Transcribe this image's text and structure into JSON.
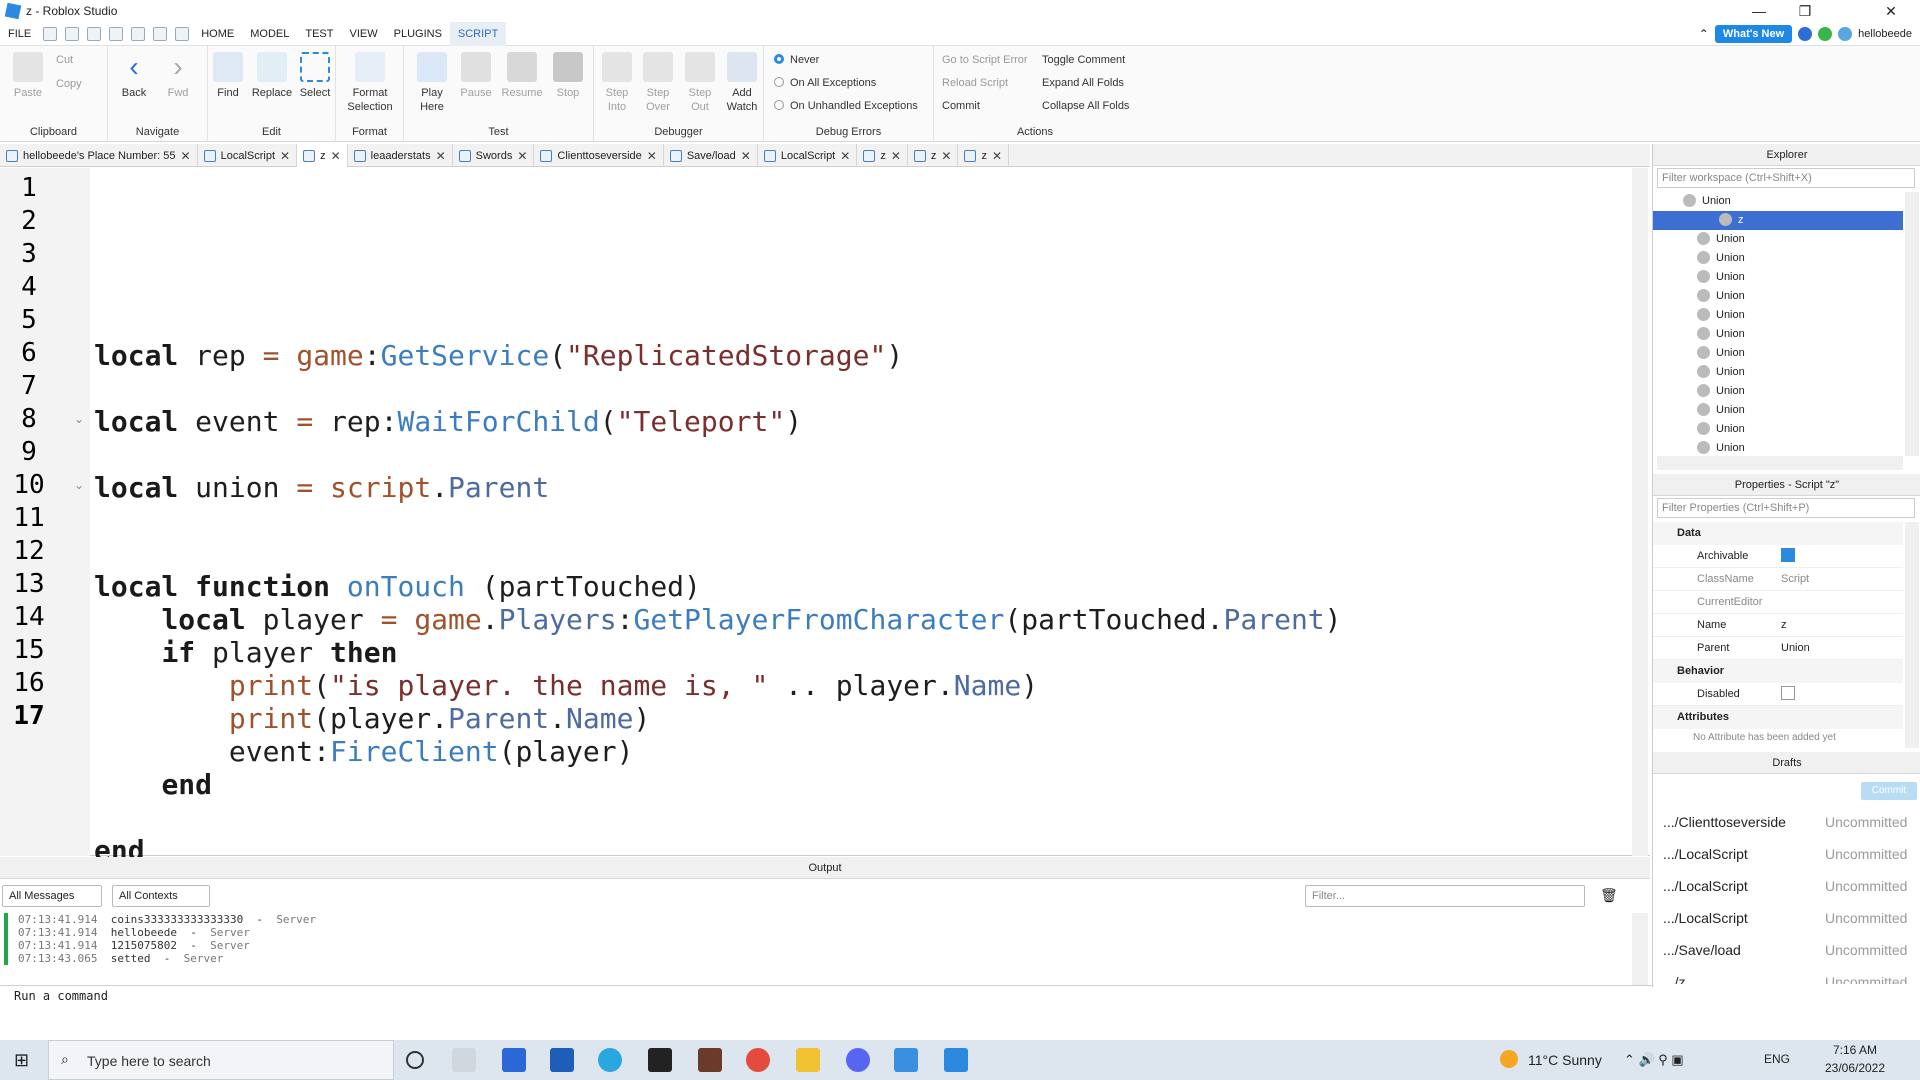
{
  "title": {
    "text": "z - Roblox Studio",
    "minimize": "—",
    "maximize": "❐",
    "close": "✕"
  },
  "menu": {
    "items": [
      "FILE",
      "HOME",
      "MODEL",
      "TEST",
      "VIEW",
      "PLUGINS",
      "SCRIPT"
    ],
    "whats_new": "What's New",
    "user": "hellobeede"
  },
  "ribbon": {
    "clipboard": {
      "label": "Clipboard",
      "paste": "Paste",
      "cut": "Cut",
      "copy": "Copy"
    },
    "navigate": {
      "label": "Navigate",
      "back": "Back",
      "fwd": "Fwd"
    },
    "edit": {
      "label": "Edit",
      "find": "Find",
      "replace": "Replace",
      "select": "Select"
    },
    "format": {
      "label": "Format",
      "format_selection": "Format Selection"
    },
    "test": {
      "label": "Test",
      "play_here": "Play Here",
      "pause": "Pause",
      "resume": "Resume",
      "stop": "Stop"
    },
    "debugger": {
      "label": "Debugger",
      "step_into": "Step Into",
      "step_over": "Step Over",
      "step_out": "Step Out",
      "add_watch": "Add Watch"
    },
    "debug_errors": {
      "label": "Debug Errors",
      "never": "Never",
      "all": "On All Exceptions",
      "unhandled": "On Unhandled Exceptions"
    },
    "actions": {
      "label": "Actions",
      "goto_error": "Go to Script Error",
      "reload": "Reload Script",
      "commit": "Commit",
      "toggle_comment": "Toggle Comment",
      "expand": "Expand All Folds",
      "collapse": "Collapse All Folds"
    }
  },
  "tabs": [
    {
      "label": "hellobeede's Place Number: 55"
    },
    {
      "label": "LocalScript"
    },
    {
      "label": "z",
      "active": true
    },
    {
      "label": "leaaderstats"
    },
    {
      "label": "Swords"
    },
    {
      "label": "Clienttoseverside"
    },
    {
      "label": "Save/load"
    },
    {
      "label": "LocalScript"
    },
    {
      "label": "z"
    },
    {
      "label": "z"
    },
    {
      "label": "z"
    }
  ],
  "tab_close": "✕",
  "editor": {
    "line_numbers": [
      "1",
      "2",
      "3",
      "4",
      "5",
      "6",
      "7",
      "8",
      "9",
      "10",
      "11",
      "12",
      "13",
      "14",
      "15",
      "16",
      "17"
    ]
  },
  "output": {
    "title": "Output",
    "filter_messages": "All Messages",
    "filter_contexts": "All Contexts",
    "filter_placeholder": "Filter...",
    "logs": [
      {
        "time": "07:13:41.914",
        "msg": "coins333333333333330",
        "ctx": "Server"
      },
      {
        "time": "07:13:41.914",
        "msg": "hellobeede",
        "ctx": "Server"
      },
      {
        "time": "07:13:41.914",
        "msg": "1215075802",
        "ctx": "Server"
      },
      {
        "time": "07:13:43.065",
        "msg": "setted",
        "ctx": "Server"
      }
    ],
    "command_placeholder": "Run a command"
  },
  "explorer": {
    "title": "Explorer",
    "filter": "Filter workspace (Ctrl+Shift+X)",
    "items": [
      "Union",
      "z",
      "Union",
      "Union",
      "Union",
      "Union",
      "Union",
      "Union",
      "Union",
      "Union",
      "Union",
      "Union",
      "Union",
      "Union"
    ]
  },
  "properties": {
    "title": "Properties - Script \"z\"",
    "filter": "Filter Properties (Ctrl+Shift+P)",
    "sections": {
      "data": "Data",
      "behavior": "Behavior",
      "attributes": "Attributes"
    },
    "rows": {
      "archivable": "Archivable",
      "classname": "ClassName",
      "classname_val": "Script",
      "current_editor": "CurrentEditor",
      "name": "Name",
      "name_val": "z",
      "parent": "Parent",
      "parent_val": "Union",
      "disabled": "Disabled"
    },
    "attr_note": "No Attribute has been added yet"
  },
  "drafts": {
    "title": "Drafts",
    "commit": "Commit",
    "items": [
      {
        "name": ".../Clienttoseverside",
        "status": "Uncommitted"
      },
      {
        "name": ".../LocalScript",
        "status": "Uncommitted"
      },
      {
        "name": ".../LocalScript",
        "status": "Uncommitted"
      },
      {
        "name": ".../LocalScript",
        "status": "Uncommitted"
      },
      {
        "name": ".../Save/load",
        "status": "Uncommitted"
      },
      {
        "name": ".../z",
        "status": "Uncommitted"
      }
    ]
  },
  "taskbar": {
    "search": "Type here to search",
    "weather": "11°C  Sunny",
    "lang": "ENG",
    "time": "7:16 AM",
    "date": "23/06/2022"
  }
}
